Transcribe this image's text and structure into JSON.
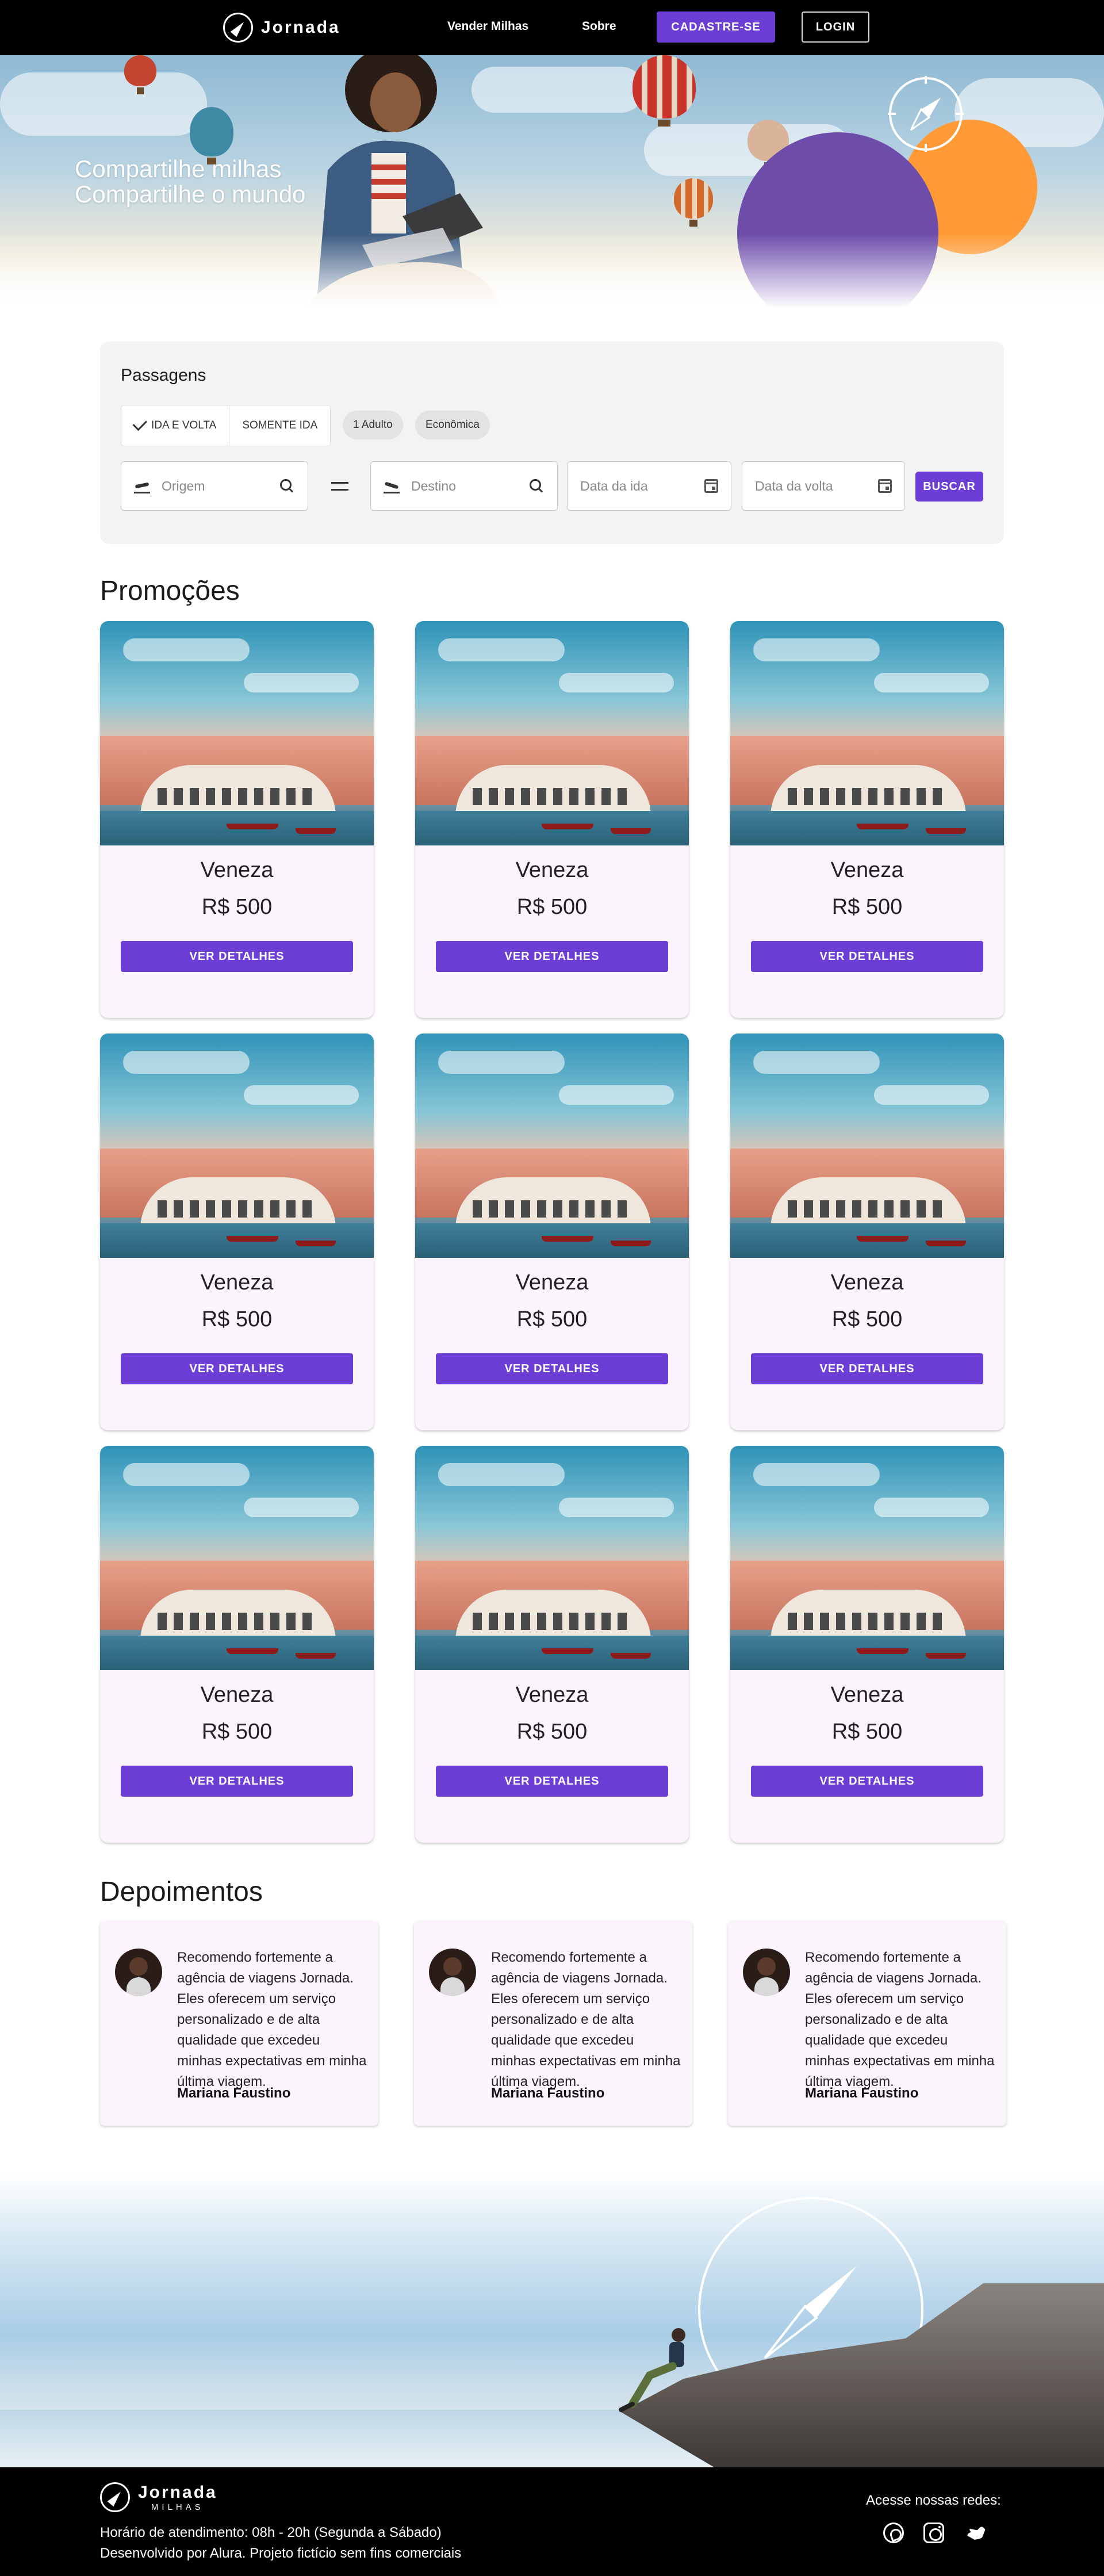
{
  "header": {
    "brand": "Jornada",
    "nav": {
      "vender_milhas": "Vender Milhas",
      "sobre": "Sobre"
    },
    "cadastro_label": "CADASTRE-SE",
    "login_label": "LOGIN"
  },
  "hero": {
    "line1": "Compartilhe milhas",
    "line2": "Compartilhe o mundo"
  },
  "search": {
    "title": "Passagens",
    "trip_types": [
      "IDA E VOLTA",
      "SOMENTE IDA"
    ],
    "selected_trip_type": "IDA E VOLTA",
    "passengers_chip": "1 Adulto",
    "class_chip": "Econômica",
    "origin_placeholder": "Origem",
    "destination_placeholder": "Destino",
    "departure_placeholder": "Data da ida",
    "return_placeholder": "Data da volta",
    "submit_label": "BUSCAR"
  },
  "promotions": {
    "title": "Promoções",
    "cards": [
      {
        "city": "Veneza",
        "price": "R$ 500",
        "button": "VER DETALHES"
      },
      {
        "city": "Veneza",
        "price": "R$ 500",
        "button": "VER DETALHES"
      },
      {
        "city": "Veneza",
        "price": "R$ 500",
        "button": "VER DETALHES"
      },
      {
        "city": "Veneza",
        "price": "R$ 500",
        "button": "VER DETALHES"
      },
      {
        "city": "Veneza",
        "price": "R$ 500",
        "button": "VER DETALHES"
      },
      {
        "city": "Veneza",
        "price": "R$ 500",
        "button": "VER DETALHES"
      },
      {
        "city": "Veneza",
        "price": "R$ 500",
        "button": "VER DETALHES"
      },
      {
        "city": "Veneza",
        "price": "R$ 500",
        "button": "VER DETALHES"
      },
      {
        "city": "Veneza",
        "price": "R$ 500",
        "button": "VER DETALHES"
      }
    ]
  },
  "testimonials": {
    "title": "Depoimentos",
    "items": [
      {
        "text": "Recomendo fortemente a agência de viagens Jornada. Eles oferecem um serviço personalizado e de alta qualidade que excedeu minhas expectativas em minha última viagem.",
        "author": "Mariana Faustino"
      },
      {
        "text": "Recomendo fortemente a agência de viagens Jornada. Eles oferecem um serviço personalizado e de alta qualidade que excedeu minhas expectativas em minha última viagem.",
        "author": "Mariana Faustino"
      },
      {
        "text": "Recomendo fortemente a agência de viagens Jornada. Eles oferecem um serviço personalizado e de alta qualidade que excedeu minhas expectativas em minha última viagem.",
        "author": "Mariana Faustino"
      }
    ]
  },
  "footer": {
    "brand": "Jornada",
    "brand_sub": "MILHAS",
    "hours": "Horário de atendimento: 08h - 20h (Segunda a Sábado)",
    "credits": "Desenvolvido por Alura. Projeto fictício sem fins comerciais",
    "social_label": "Acesse nossas redes:",
    "social_icons": [
      "whatsapp-icon",
      "instagram-icon",
      "twitter-icon"
    ]
  },
  "colors": {
    "primary": "#6d3ed6",
    "accent_orange": "#ff9a36",
    "accent_purple": "#6d4caa",
    "card_bg": "#fcf4fd",
    "header_bg": "#000000"
  }
}
